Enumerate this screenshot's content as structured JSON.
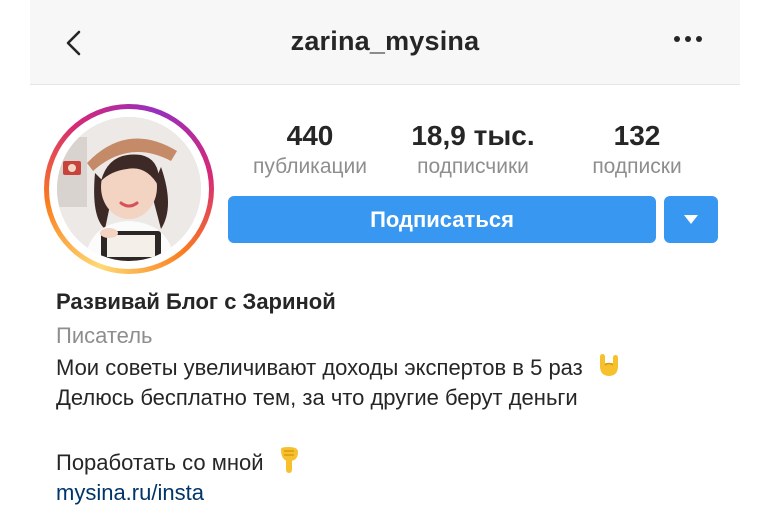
{
  "header": {
    "username": "zarina_mysina",
    "back_icon": "chevron-left-icon",
    "more_icon": "more-horizontal-icon"
  },
  "profile": {
    "avatar_icon": "profile-photo",
    "stats": [
      {
        "value": "440",
        "label": "публикации"
      },
      {
        "value": "18,9 тыс.",
        "label": "подписчики"
      },
      {
        "value": "132",
        "label": "подписки"
      }
    ],
    "follow_label": "Подписаться",
    "dropdown_icon": "caret-down-icon"
  },
  "bio": {
    "name": "Развивай Блог с Зариной",
    "category": "Писатель",
    "line1": "Мои советы увеличивают доходы экспертов в 5 раз",
    "line2": "Делюсь бесплатно тем, за что другие берут деньги",
    "line3": "Поработать со мной",
    "link": "mysina.ru/insta"
  },
  "colors": {
    "accent": "#3897f0",
    "link": "#003569",
    "muted": "#8e8e8e",
    "header_bg": "#f7f7f7"
  }
}
